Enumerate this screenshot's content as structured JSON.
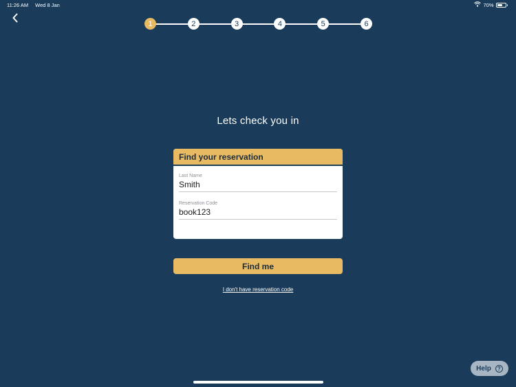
{
  "status_bar": {
    "time": "11:26 AM",
    "date": "Wed 8 Jan",
    "battery_text": "70%",
    "battery_level": 0.7
  },
  "stepper": {
    "steps": [
      "1",
      "2",
      "3",
      "4",
      "5",
      "6"
    ],
    "active_step": 1
  },
  "title": "Lets check you in",
  "reservation_card": {
    "header": "Find your reservation",
    "last_name": {
      "label": "Last Name",
      "value": "Smith"
    },
    "reservation_code": {
      "label": "Reservation Code",
      "value": "book123"
    }
  },
  "find_button": {
    "label": "Find me"
  },
  "no_code_link": "I don't have reservation code",
  "help_button": {
    "label": "Help",
    "icon_glyph": "?"
  },
  "colors": {
    "background": "#1a3c5a",
    "accent": "#e8bb63",
    "help_bg": "#a7b6c2"
  },
  "icons": {
    "back": "chevron-left-icon",
    "wifi": "wifi-icon",
    "battery": "battery-icon",
    "help": "question-circle-icon"
  }
}
